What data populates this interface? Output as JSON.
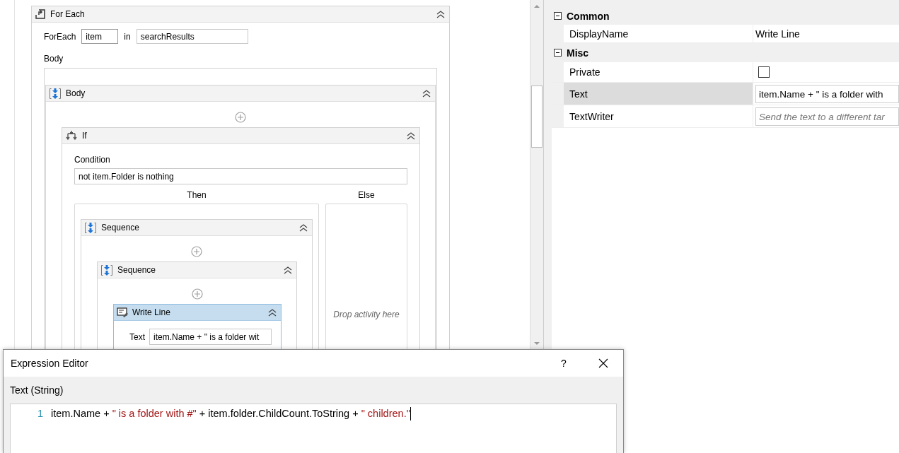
{
  "designer": {
    "root": {
      "kind": "for_each",
      "title": "For Each",
      "selected": false,
      "foreach_label": "ForEach",
      "variable": "item",
      "in_label": "in",
      "collection": "searchResults",
      "body_label": "Body",
      "body": {
        "kind": "sequence",
        "title": "Body",
        "selected": false,
        "children": [
          {
            "kind": "if",
            "title": "If",
            "selected": false,
            "condition_label": "Condition",
            "condition": "not item.Folder is nothing",
            "then_label": "Then",
            "else_label": "Else",
            "else_placeholder": "Drop activity here",
            "then": {
              "kind": "sequence",
              "title": "Sequence",
              "selected": false,
              "children": [
                {
                  "kind": "sequence",
                  "title": "Sequence",
                  "selected": false,
                  "children": [
                    {
                      "kind": "write_line",
                      "title": "Write Line",
                      "selected": true,
                      "text_label": "Text",
                      "text": "item.Name + \" is a folder wit"
                    }
                  ]
                }
              ]
            }
          }
        ]
      }
    }
  },
  "properties": {
    "categories": [
      {
        "name": "Common",
        "expanded": true,
        "rows": [
          {
            "name": "DisplayName",
            "kind": "text",
            "selected": false,
            "value": "Write Line"
          }
        ]
      },
      {
        "name": "Misc",
        "expanded": true,
        "rows": [
          {
            "name": "Private",
            "kind": "checkbox",
            "selected": false,
            "checked": false
          },
          {
            "name": "Text",
            "kind": "expression",
            "selected": true,
            "value": "item.Name + \" is a folder with"
          },
          {
            "name": "TextWriter",
            "kind": "expression",
            "selected": false,
            "placeholder": "Send the text to a different tar"
          }
        ]
      }
    ]
  },
  "expression_editor": {
    "title": "Expression Editor",
    "help": "?",
    "label": "Text (String)",
    "lines": [
      {
        "number": "1",
        "tokens": [
          {
            "kind": "code",
            "text": "item.Name + "
          },
          {
            "kind": "string",
            "text": "\" is a folder with #\""
          },
          {
            "kind": "code",
            "text": " + item.folder.ChildCount.ToString + "
          },
          {
            "kind": "string",
            "text": "\" children.\""
          }
        ]
      }
    ]
  }
}
